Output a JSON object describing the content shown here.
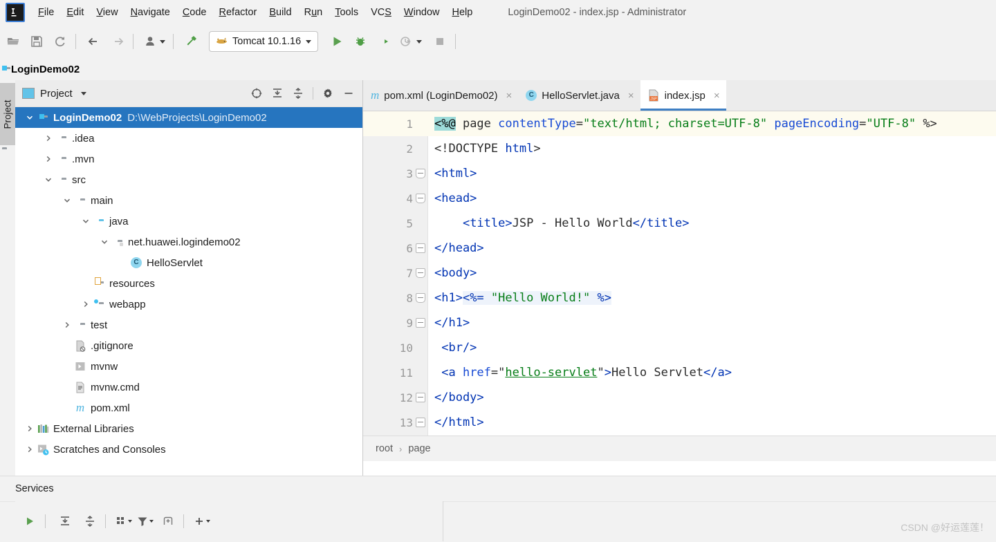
{
  "window": {
    "title": "LoginDemo02 - index.jsp - Administrator",
    "logo_text": "IJ"
  },
  "menubar": {
    "items": [
      {
        "label": "File",
        "mnemonic": "F"
      },
      {
        "label": "Edit",
        "mnemonic": "E"
      },
      {
        "label": "View",
        "mnemonic": "V"
      },
      {
        "label": "Navigate",
        "mnemonic": "N"
      },
      {
        "label": "Code",
        "mnemonic": "C"
      },
      {
        "label": "Refactor",
        "mnemonic": "R"
      },
      {
        "label": "Build",
        "mnemonic": "B"
      },
      {
        "label": "Run",
        "mnemonic": "u"
      },
      {
        "label": "Tools",
        "mnemonic": "T"
      },
      {
        "label": "VCS",
        "mnemonic": "S"
      },
      {
        "label": "Window",
        "mnemonic": "W"
      },
      {
        "label": "Help",
        "mnemonic": "H"
      }
    ]
  },
  "toolbar": {
    "buttons": [
      {
        "name": "open-project-icon",
        "glyph": "folder-open"
      },
      {
        "name": "save-all-icon",
        "glyph": "save"
      },
      {
        "name": "sync-icon",
        "glyph": "refresh"
      },
      {
        "name": "back-icon",
        "glyph": "arrow-left"
      },
      {
        "name": "forward-icon",
        "glyph": "arrow-right"
      },
      {
        "name": "profile-icon",
        "glyph": "person"
      },
      {
        "name": "build-hammer-icon",
        "glyph": "hammer"
      }
    ],
    "run_config": {
      "label": "Tomcat 10.1.16",
      "icon": "tomcat-cat-icon"
    },
    "run_label": "Run",
    "debug_label": "Debug",
    "run_coverage_label": "Run with Coverage",
    "profile_label": "Profiler",
    "stop_label": "Stop"
  },
  "project_bar": {
    "label": "LoginDemo02"
  },
  "stripe": {
    "tab_label": "Project"
  },
  "tool_window": {
    "title": "Project",
    "icons": [
      {
        "name": "select-opened-file-icon"
      },
      {
        "name": "expand-all-icon"
      },
      {
        "name": "collapse-all-icon"
      },
      {
        "name": "settings-gear-icon"
      },
      {
        "name": "hide-icon"
      }
    ],
    "tree": [
      {
        "depth": 0,
        "arrow": "down",
        "icon": "project-module-icon",
        "label": "LoginDemo02",
        "path": "D:\\WebProjects\\LoginDemo02",
        "selected": true
      },
      {
        "depth": 1,
        "arrow": "right",
        "icon": "folder-icon",
        "label": ".idea",
        "path": "",
        "selected": false
      },
      {
        "depth": 1,
        "arrow": "right",
        "icon": "folder-icon",
        "label": ".mvn",
        "path": "",
        "selected": false
      },
      {
        "depth": 1,
        "arrow": "down",
        "icon": "folder-icon",
        "label": "src",
        "path": "",
        "selected": false
      },
      {
        "depth": 2,
        "arrow": "down",
        "icon": "folder-icon",
        "label": "main",
        "path": "",
        "selected": false
      },
      {
        "depth": 3,
        "arrow": "down",
        "icon": "source-root-icon",
        "label": "java",
        "path": "",
        "selected": false
      },
      {
        "depth": 4,
        "arrow": "down",
        "icon": "package-icon",
        "label": "net.huawei.logindemo02",
        "path": "",
        "selected": false
      },
      {
        "depth": 5,
        "arrow": "none",
        "icon": "java-class-icon",
        "label": "HelloServlet",
        "path": "",
        "selected": false
      },
      {
        "depth": 3,
        "arrow": "none",
        "icon": "resource-root-icon",
        "label": "resources",
        "path": "",
        "selected": false
      },
      {
        "depth": 3,
        "arrow": "right",
        "icon": "webapp-root-icon",
        "label": "webapp",
        "path": "",
        "selected": false
      },
      {
        "depth": 2,
        "arrow": "right",
        "icon": "folder-icon",
        "label": "test",
        "path": "",
        "selected": false
      },
      {
        "depth": 2,
        "arrow": "none",
        "icon": "gitignore-file-icon",
        "label": ".gitignore",
        "path": "",
        "selected": false
      },
      {
        "depth": 2,
        "arrow": "none",
        "icon": "script-file-icon",
        "label": "mvnw",
        "path": "",
        "selected": false
      },
      {
        "depth": 2,
        "arrow": "none",
        "icon": "cmd-file-icon",
        "label": "mvnw.cmd",
        "path": "",
        "selected": false
      },
      {
        "depth": 2,
        "arrow": "none",
        "icon": "maven-file-icon",
        "label": "pom.xml",
        "path": "",
        "selected": false
      },
      {
        "depth": 0,
        "arrow": "right",
        "icon": "external-libraries-icon",
        "label": "External Libraries",
        "path": "",
        "selected": false
      },
      {
        "depth": 0,
        "arrow": "right",
        "icon": "scratches-icon",
        "label": "Scratches and Consoles",
        "path": "",
        "selected": false
      }
    ]
  },
  "editor": {
    "tabs": [
      {
        "label": "pom.xml (LoginDemo02)",
        "icon": "maven-file-icon",
        "active": false,
        "close": "×"
      },
      {
        "label": "HelloServlet.java",
        "icon": "java-class-icon",
        "active": false,
        "close": "×"
      },
      {
        "label": "index.jsp",
        "icon": "jsp-file-icon",
        "active": true,
        "close": "×"
      }
    ],
    "lines": [
      {
        "num": "1",
        "fold": "none",
        "highlight": true,
        "tokens": [
          {
            "t": "<%@",
            "c": "k-dir"
          },
          {
            "t": " page ",
            "c": "k-plain"
          },
          {
            "t": "contentType",
            "c": "k-attr"
          },
          {
            "t": "=",
            "c": "k-plain"
          },
          {
            "t": "\"text/html; charset=UTF-8\"",
            "c": "k-str"
          },
          {
            "t": " ",
            "c": "k-plain"
          },
          {
            "t": "pageEncoding",
            "c": "k-attr"
          },
          {
            "t": "=",
            "c": "k-plain"
          },
          {
            "t": "\"UTF-8\"",
            "c": "k-str"
          },
          {
            "t": " %>",
            "c": "k-plain"
          }
        ]
      },
      {
        "num": "2",
        "fold": "none",
        "highlight": false,
        "tokens": [
          {
            "t": "<!DOCTYPE ",
            "c": "k-plain"
          },
          {
            "t": "html",
            "c": "k-tag"
          },
          {
            "t": ">",
            "c": "k-plain"
          }
        ]
      },
      {
        "num": "3",
        "fold": "open",
        "highlight": false,
        "tokens": [
          {
            "t": "<html>",
            "c": "k-tag"
          }
        ]
      },
      {
        "num": "4",
        "fold": "open",
        "highlight": false,
        "tokens": [
          {
            "t": "<head>",
            "c": "k-tag"
          }
        ]
      },
      {
        "num": "5",
        "fold": "none",
        "highlight": false,
        "tokens": [
          {
            "t": "    ",
            "c": "k-plain"
          },
          {
            "t": "<title>",
            "c": "k-tag"
          },
          {
            "t": "JSP - Hello World",
            "c": "k-plain"
          },
          {
            "t": "</title>",
            "c": "k-tag"
          }
        ]
      },
      {
        "num": "6",
        "fold": "close",
        "highlight": false,
        "tokens": [
          {
            "t": "</head>",
            "c": "k-tag"
          }
        ]
      },
      {
        "num": "7",
        "fold": "open",
        "highlight": false,
        "tokens": [
          {
            "t": "<body>",
            "c": "k-tag"
          }
        ]
      },
      {
        "num": "8",
        "fold": "open",
        "highlight": false,
        "tokens": [
          {
            "t": "<h1>",
            "c": "k-tag"
          },
          {
            "t": "<%= ",
            "c": "k-jsp hl-embed"
          },
          {
            "t": "\"Hello World!\"",
            "c": "k-str hl-embed"
          },
          {
            "t": " ",
            "c": "hl-embed"
          },
          {
            "t": "%>",
            "c": "k-jsp hl-embed"
          }
        ]
      },
      {
        "num": "9",
        "fold": "close",
        "highlight": false,
        "tokens": [
          {
            "t": "</h1>",
            "c": "k-tag"
          }
        ]
      },
      {
        "num": "10",
        "fold": "none",
        "highlight": false,
        "tokens": [
          {
            "t": " <br/>",
            "c": "k-tag"
          }
        ]
      },
      {
        "num": "11",
        "fold": "none",
        "highlight": false,
        "tokens": [
          {
            "t": " <a ",
            "c": "k-tag"
          },
          {
            "t": "href",
            "c": "k-attr"
          },
          {
            "t": "=\"",
            "c": "k-plain"
          },
          {
            "t": "hello-servlet",
            "c": "k-link"
          },
          {
            "t": "\"",
            "c": "k-plain"
          },
          {
            "t": ">",
            "c": "k-tag"
          },
          {
            "t": "Hello Servlet",
            "c": "k-plain"
          },
          {
            "t": "</a>",
            "c": "k-tag"
          }
        ]
      },
      {
        "num": "12",
        "fold": "close",
        "highlight": false,
        "tokens": [
          {
            "t": "</body>",
            "c": "k-tag"
          }
        ]
      },
      {
        "num": "13",
        "fold": "close",
        "highlight": false,
        "tokens": [
          {
            "t": "</html>",
            "c": "k-tag"
          }
        ]
      }
    ],
    "breadcrumbs": [
      "root",
      "page"
    ],
    "breadcrumb_sep": "›"
  },
  "services": {
    "title": "Services",
    "buttons": [
      {
        "name": "run-service-icon"
      },
      {
        "name": "expand-all-icon"
      },
      {
        "name": "collapse-all-icon"
      },
      {
        "name": "group-by-icon"
      },
      {
        "name": "filter-icon"
      },
      {
        "name": "show-configurations-icon"
      },
      {
        "name": "add-service-icon"
      }
    ]
  },
  "watermark": {
    "text": "CSDN @好运莲莲！"
  },
  "colors": {
    "accent_blue": "#2675bf",
    "tab_underline": "#3e7fc4",
    "run_green": "#5aa04f",
    "string_green": "#067d17",
    "tag_blue": "#0033b3",
    "directive_bg": "#9ddbd9",
    "line_highlight": "#fdfbef"
  }
}
